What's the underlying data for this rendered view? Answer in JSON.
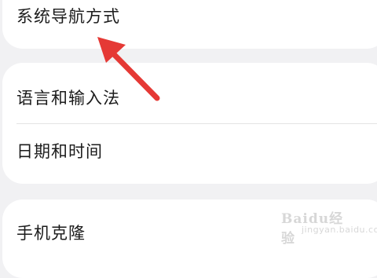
{
  "settings": {
    "items": [
      {
        "label": "系统导航方式"
      },
      {
        "label": "语言和输入法"
      },
      {
        "label": "日期和时间"
      },
      {
        "label": "手机克隆"
      }
    ]
  },
  "annotation": {
    "arrow_color": "#e53935"
  },
  "watermark": {
    "brand": "Baidu经验",
    "sub": "jingyan.baidu.com"
  },
  "colors": {
    "background": "#f1f1f3",
    "card": "#ffffff",
    "text": "#1b1b1b",
    "chevron": "#c2c2c2"
  },
  "icons": [
    "chevron-right-icon",
    "red-arrow-annotation"
  ]
}
